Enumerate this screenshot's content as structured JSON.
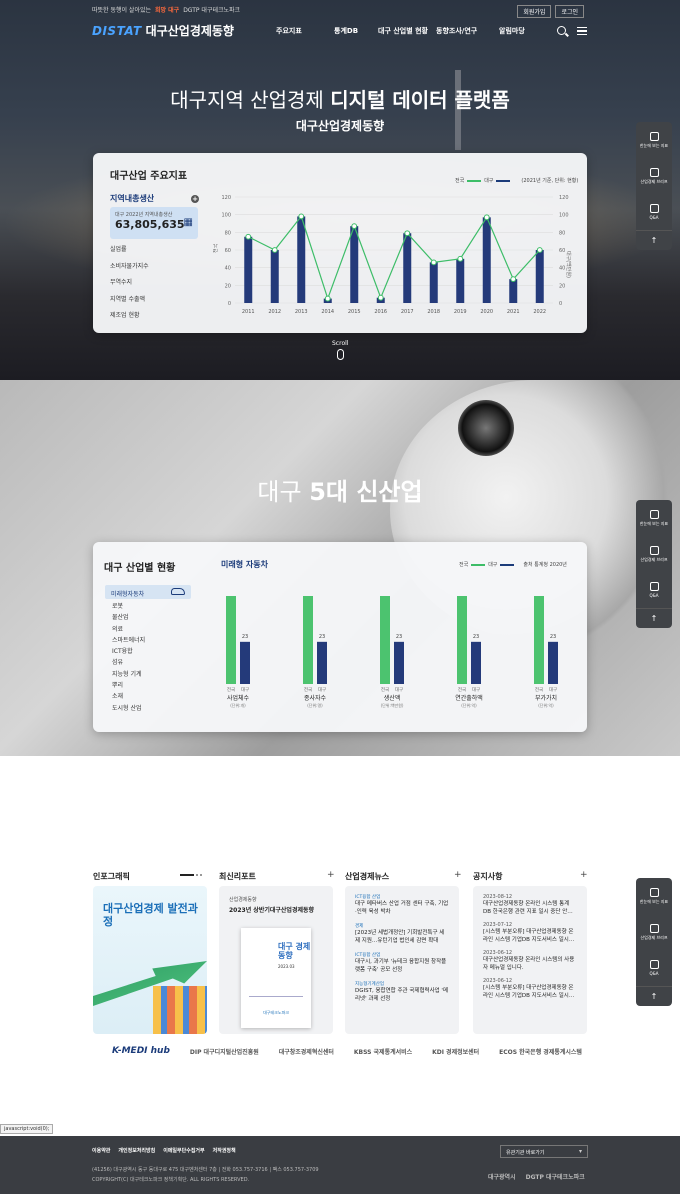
{
  "header": {
    "sub_brand_left": "따뜻한 동행이 살아있는",
    "sub_brand_tag": "희망 대구",
    "sub_brand_right": "DGTP 대구테크노파크",
    "brand": "DISTAT",
    "title": "대구산업경제동향",
    "join": "회원가입",
    "login": "로그인",
    "nav": [
      "주요지표",
      "통계DB",
      "대구 산업별 현황",
      "동향조사/연구",
      "알림마당"
    ]
  },
  "hero": {
    "title_prefix": "대구지역 산업경제 ",
    "title_bold": "디지털 데이터 플랫폼",
    "subtitle": "대구산업경제동향"
  },
  "indicators": {
    "title": "대구산업 주요지표",
    "active": "지역내총생산",
    "box_caption": "대구 2022년 지역내총생산",
    "box_value": "63,805,635",
    "items": [
      "실업률",
      "소비자물가지수",
      "무역수지",
      "지역별 수출액",
      "제조업 현황"
    ],
    "legend_national": "전국",
    "legend_daegu": "대구",
    "unit_note": "(2021년 기준, 단위: 현황)",
    "y_left_label": "전국",
    "y_right_label": "대구(백만원)"
  },
  "scroll_label": "Scroll",
  "section2": {
    "title_prefix": "대구 ",
    "title_bold": "5대 신산업"
  },
  "industry": {
    "title": "대구 산업별 현황",
    "active": "미래형자동차",
    "items": [
      "로봇",
      "물산업",
      "의료",
      "스마트에너지",
      "ICT융합",
      "섬유",
      "지능형 기계",
      "뿌리",
      "소재",
      "도시형 산업"
    ],
    "subtitle": "미래형 자동차",
    "legend_national": "전국",
    "legend_daegu": "대구",
    "source_note": "출처 통계청 2020년"
  },
  "bottom": {
    "infographic": {
      "title": "인포그래픽",
      "headline": "대구산업경제 발전과정"
    },
    "report": {
      "title": "최신리포트",
      "caption": "산업경제동향",
      "headline": "2023년 상반기대구산업경제동향",
      "book_title": "대구 경제동향",
      "book_year": "2023.03",
      "book_org": "대구테크노파크"
    },
    "news": {
      "title": "산업경제뉴스",
      "items": [
        {
          "cat": "ICT융합 산업",
          "text": "대구 메타버스 산업 거점 센터 구축, 기업·인력 육성 박차"
        },
        {
          "cat": "경제",
          "text": "[2023년 세법개정안] 기회발전특구 세제 지원…유턴기업 법인세 감면 확대"
        },
        {
          "cat": "ICT융합 산업",
          "text": "대구시, 과기부 '뉴테크 융합지원 창작플랫폼 구축' 공모 선정"
        },
        {
          "cat": "지능형기계산업",
          "text": "DGIST, 융합연합 주관 국제협력사업 '메리넷' 과제 선정"
        }
      ]
    },
    "notice": {
      "title": "공지사항",
      "items": [
        {
          "date": "2023-08-12",
          "text": "대구산업경제동향 온라인 시스템 통계DB 한국은행 관련 지표 일시 중단 안…"
        },
        {
          "date": "2023-07-12",
          "text": "[시스템 부분오류] 대구산업경제동향 온라인 시스템 기업DB 지도서비스 일시…"
        },
        {
          "date": "2023-06-12",
          "text": "대구산업경제동향 온라인 시스템의 사용자 메뉴얼 입니다."
        },
        {
          "date": "2023-06-12",
          "text": "[시스템 부분오류] 대구산업경제동향 온라인 시스템 기업DB 지도서비스 일시…"
        }
      ]
    }
  },
  "partners": [
    "K-MEDI hub",
    "DIP 대구디지털산업진흥원",
    "대구창조경제혁신센터",
    "KBSS 국제통계서비스",
    "KDI 경제정보센터",
    "ECOS 한국은행 경제통계시스템"
  ],
  "status_tip": "javascript:void(0);",
  "footer": {
    "links": [
      "이용약관",
      "개인정보처리방침",
      "이메일무단수집거부",
      "저작권정책"
    ],
    "address": "(41256) 대구광역시 동구 동대구로 475 대구벤처센터 7층 | 전화 053.757-3716 | 팩스 053.757-3709",
    "copyright": "COPYRIGHT(C) 대구테크노파크 정책기획단. ALL RIGHTS RESERVED.",
    "related_select": "유관기관 바로가기",
    "logo1": "대구광역시",
    "logo2": "DGTP 대구테크노파크"
  },
  "quick_menu": [
    "한눈에 보는 지표",
    "산업경제 브리프",
    "Q&A"
  ],
  "colors": {
    "accent_navy": "#1b3b7a",
    "accent_green": "#3dbd68",
    "brand_blue": "#4aa3ff"
  },
  "chart_data": [
    {
      "type": "bar",
      "title": "지역내총생산",
      "categories": [
        "2011",
        "2012",
        "2013",
        "2014",
        "2015",
        "2016",
        "2017",
        "2018",
        "2019",
        "2020",
        "2021",
        "2022"
      ],
      "series": [
        {
          "name": "대구",
          "type": "bar",
          "values": [
            75,
            60,
            98,
            5,
            87,
            6,
            79,
            46,
            50,
            97,
            27,
            60
          ]
        },
        {
          "name": "전국",
          "type": "line",
          "values": [
            75,
            60,
            98,
            5,
            87,
            6,
            79,
            46,
            50,
            97,
            27,
            60
          ]
        }
      ],
      "ylim": [
        0,
        120
      ],
      "yticks": [
        0,
        20,
        40,
        60,
        80,
        100,
        120
      ]
    },
    {
      "type": "bar",
      "categories": [
        "사업체수",
        "종사자수",
        "생산액",
        "연간출하액",
        "부가가치"
      ],
      "units": [
        "(단위:개)",
        "(단위:명)",
        "(단위:백만원)",
        "(단위:억)",
        "(단위:억)"
      ],
      "series": [
        {
          "name": "전국",
          "values": [
            48,
            48,
            48,
            48,
            48
          ]
        },
        {
          "name": "대구",
          "values": [
            23,
            23,
            23,
            23,
            23
          ]
        }
      ]
    }
  ]
}
